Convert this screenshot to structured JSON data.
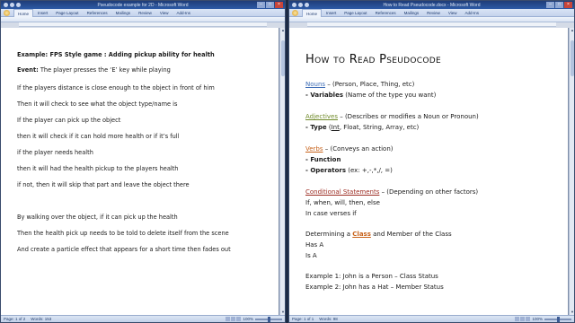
{
  "left_window": {
    "title": "Pseudocode example for 2D - Microsoft Word",
    "tabs": [
      "Home",
      "Insert",
      "Page Layout",
      "References",
      "Mailings",
      "Review",
      "View",
      "Add-Ins"
    ],
    "status": {
      "page": "Page: 1 of 2",
      "words": "Words: 153",
      "zoom": "100%"
    },
    "lines": [
      {
        "bold_prefix": "Example: FPS Style game : Adding pickup ability for health",
        "text": ""
      },
      {
        "bold_prefix": "Event:",
        "text": " The player presses the ‘E’ key while playing"
      },
      {
        "bold_prefix": "",
        "text": "If the players distance is close enough to the object in front of him"
      },
      {
        "bold_prefix": "",
        "text": "Then it will check to see what the object type/name is"
      },
      {
        "bold_prefix": "",
        "text": "If the player can pick up the object"
      },
      {
        "bold_prefix": "",
        "text": "then it will check if it can hold more health or if it’s full"
      },
      {
        "bold_prefix": "",
        "text": "if the player needs health"
      },
      {
        "bold_prefix": "",
        "text": "then it will had the health pickup to the players health"
      },
      {
        "bold_prefix": "",
        "text": "if not, then it will skip that part and leave the object there"
      },
      {
        "bold_prefix": "",
        "text": "By walking over the object, if it can pick up the health"
      },
      {
        "bold_prefix": "",
        "text": "Then the health pick up needs to be told to delete itself from the scene"
      },
      {
        "bold_prefix": "",
        "text": "And create a particle effect that appears for a short time then fades out"
      }
    ]
  },
  "right_window": {
    "title": "How to Read Pseudocode.docx - Microsoft Word",
    "tabs": [
      "Home",
      "Insert",
      "Page Layout",
      "References",
      "Mailings",
      "Review",
      "View",
      "Add-Ins"
    ],
    "status": {
      "page": "Page: 1 of 1",
      "words": "Words: 98",
      "zoom": "100%"
    },
    "heading": "How to Read Pseudocode",
    "nouns": {
      "term": "Nouns",
      "desc": " – (Person, Place, Thing, etc)"
    },
    "variables": {
      "bullet": "- Variables",
      "desc": " (Name of the type you want)"
    },
    "adjectives": {
      "term": "Adjectives",
      "desc": " – (Describes or modifies a Noun or Pronoun)"
    },
    "type": {
      "bullet": "- Type",
      "desc_pre": " (",
      "int": "Int",
      "desc_post": ", Float, String, Array, etc)"
    },
    "verbs": {
      "term": "Verbs",
      "desc": " – (Conveys an action)"
    },
    "function": "- Function",
    "operators": {
      "bullet": "- Operators",
      "desc": " (ex: +,-,*,/, =)"
    },
    "conditional": {
      "term": "Conditional Statements",
      "desc": " – (Depending on other factors)"
    },
    "if_list": "If, when, will, then, else",
    "in_case": "In case verses if",
    "determining": {
      "pre": "Determining a ",
      "class": "Class",
      "post": " and Member of the Class"
    },
    "has_a": "Has A",
    "is_a": "Is A",
    "example1": "Example 1: John is a Person – Class Status",
    "example2": "Example 2: John has a Hat – Member Status"
  },
  "colors": {
    "nouns": "#3b6bb5",
    "adjectives": "#6f8a2a",
    "verbs": "#c7621a",
    "conditional": "#9c2c22"
  }
}
